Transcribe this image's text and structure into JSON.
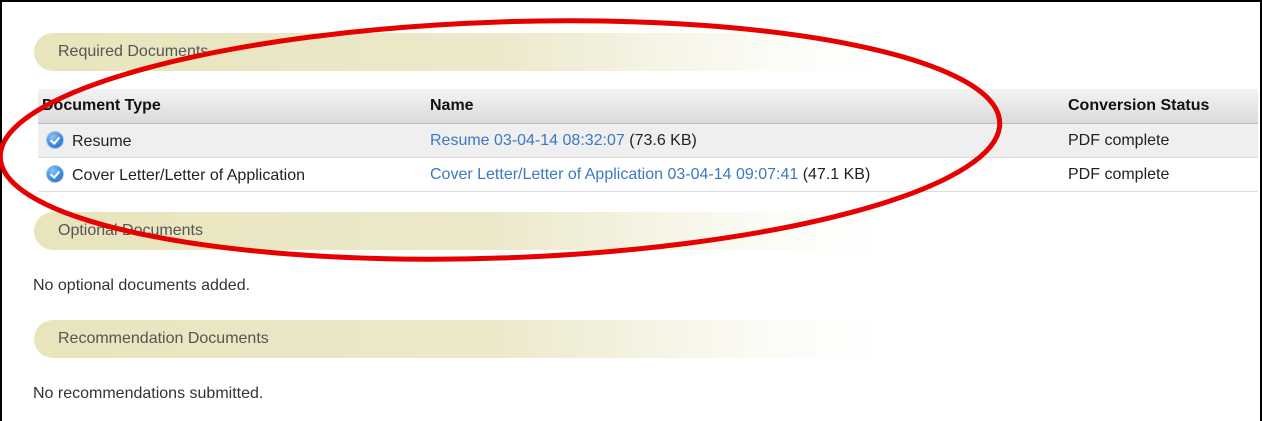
{
  "sections": {
    "required": {
      "title": "Required Documents",
      "columns": [
        "Document Type",
        "Name",
        "Conversion Status"
      ],
      "rows": [
        {
          "type": "Resume",
          "name_link": "Resume 03-04-14 08:32:07",
          "size": "(73.6 KB)",
          "status": "PDF complete"
        },
        {
          "type": "Cover Letter/Letter of Application",
          "name_link": "Cover Letter/Letter of Application 03-04-14 09:07:41",
          "size": "(47.1 KB)",
          "status": "PDF complete"
        }
      ]
    },
    "optional": {
      "title": "Optional Documents",
      "empty_message": "No optional documents added."
    },
    "recommendation": {
      "title": "Recommendation Documents",
      "empty_message": "No recommendations submitted."
    }
  },
  "icons": {
    "row_status": "check-circle-icon"
  },
  "colors": {
    "link": "#3a79c4",
    "section_header_bg": "#e8e4bc",
    "annotation_ellipse": "#e60000"
  }
}
